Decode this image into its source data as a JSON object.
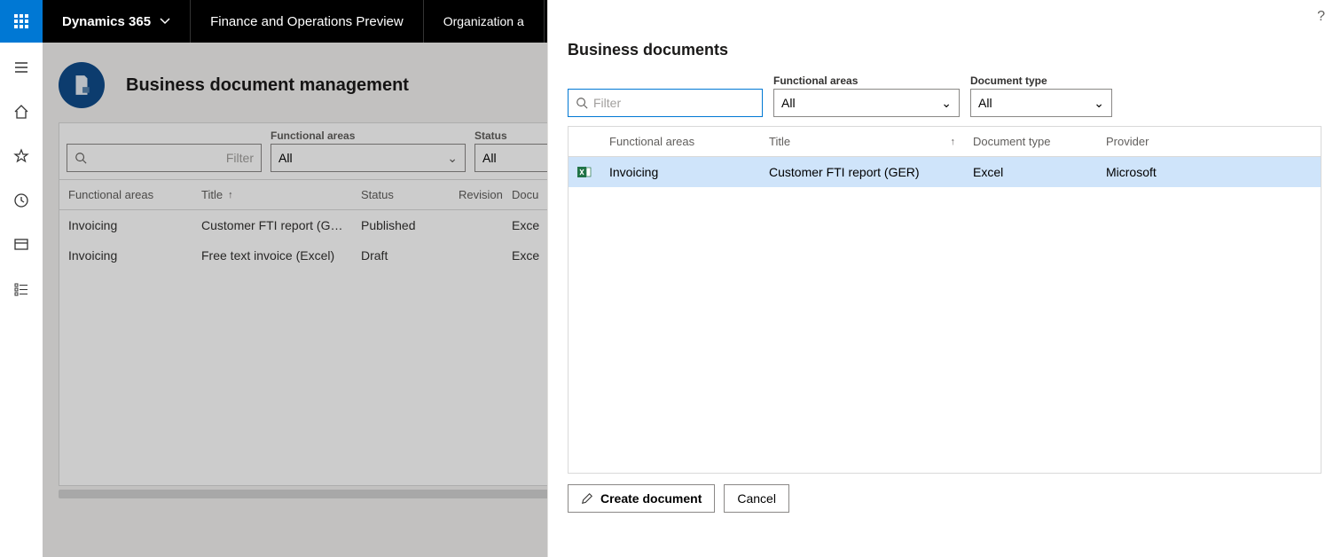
{
  "topbar": {
    "brand": "Dynamics 365",
    "app": "Finance and Operations Preview",
    "breadcrumb": "Organization a"
  },
  "page": {
    "title": "Business document management"
  },
  "back_filters": {
    "filter_placeholder": "Filter",
    "functional_areas_label": "Functional areas",
    "functional_areas_value": "All",
    "status_label": "Status",
    "status_value": "All"
  },
  "back_grid": {
    "columns": {
      "functional_areas": "Functional areas",
      "title": "Title",
      "status": "Status",
      "revision": "Revision",
      "doc": "Docu"
    },
    "rows": [
      {
        "fa": "Invoicing",
        "title": "Customer FTI report (GER)",
        "status": "Published",
        "rev": "",
        "doc": "Exce"
      },
      {
        "fa": "Invoicing",
        "title": "Free text invoice (Excel)",
        "status": "Draft",
        "rev": "",
        "doc": "Exce"
      }
    ]
  },
  "panel": {
    "title": "Business documents",
    "filter_placeholder": "Filter",
    "functional_areas_label": "Functional areas",
    "functional_areas_value": "All",
    "document_type_label": "Document type",
    "document_type_value": "All",
    "grid_columns": {
      "functional_areas": "Functional areas",
      "title": "Title",
      "document_type": "Document type",
      "provider": "Provider"
    },
    "rows": [
      {
        "fa": "Invoicing",
        "title": "Customer FTI report (GER)",
        "doc_type": "Excel",
        "provider": "Microsoft"
      }
    ],
    "create_label": "Create document",
    "cancel_label": "Cancel"
  }
}
